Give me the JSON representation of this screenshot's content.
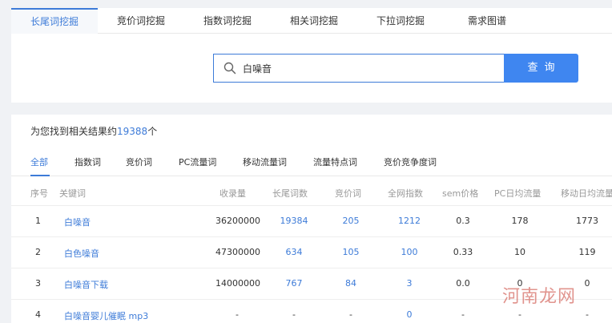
{
  "top_tabs": [
    {
      "label": "长尾词挖掘",
      "active": true
    },
    {
      "label": "竞价词挖掘",
      "active": false
    },
    {
      "label": "指数词挖掘",
      "active": false
    },
    {
      "label": "相关词挖掘",
      "active": false
    },
    {
      "label": "下拉词挖掘",
      "active": false
    },
    {
      "label": "需求图谱",
      "active": false
    }
  ],
  "search": {
    "value": "白噪音",
    "button_label": "查询"
  },
  "results": {
    "prefix": "为您找到相关结果约",
    "count": "19388",
    "suffix": "个"
  },
  "sub_tabs": [
    "全部",
    "指数词",
    "竞价词",
    "PC流量词",
    "移动流量词",
    "流量特点词",
    "竞价竞争度词"
  ],
  "columns": [
    "序号",
    "关键词",
    "收录量",
    "长尾词数",
    "竞价词",
    "全网指数",
    "sem价格",
    "PC日均流量",
    "移动日均流量"
  ],
  "rows": [
    [
      "1",
      "白噪音",
      "36200000",
      "19384",
      "205",
      "1212",
      "0.3",
      "178",
      "1773"
    ],
    [
      "2",
      "白色噪音",
      "47300000",
      "634",
      "105",
      "100",
      "0.33",
      "10",
      "119"
    ],
    [
      "3",
      "白噪音下载",
      "14000000",
      "767",
      "84",
      "3",
      "0.0",
      "0",
      "0"
    ],
    [
      "4",
      "白噪音婴儿催眠 mp3",
      "-",
      "-",
      "-",
      "0",
      "-",
      "-",
      "-"
    ]
  ],
  "watermark": "河南龙网"
}
